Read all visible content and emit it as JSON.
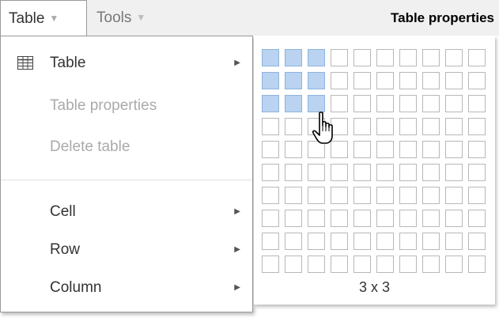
{
  "menubar": {
    "table_label": "Table",
    "tools_label": "Tools",
    "dialog_title": "Table properties"
  },
  "dropdown": {
    "items": [
      {
        "label": "Table",
        "icon": "table-grid-icon",
        "disabled": false,
        "submenu": true
      },
      {
        "label": "Table properties",
        "disabled": true,
        "submenu": false
      },
      {
        "label": "Delete table",
        "disabled": true,
        "submenu": false
      },
      {
        "label": "Cell",
        "disabled": false,
        "submenu": true
      },
      {
        "label": "Row",
        "disabled": false,
        "submenu": true
      },
      {
        "label": "Column",
        "disabled": false,
        "submenu": true
      }
    ]
  },
  "picker": {
    "cols": 10,
    "rows": 10,
    "selected_cols": 3,
    "selected_rows": 3,
    "size_label": "3 x 3",
    "selected_color": "#b9d3f0"
  }
}
